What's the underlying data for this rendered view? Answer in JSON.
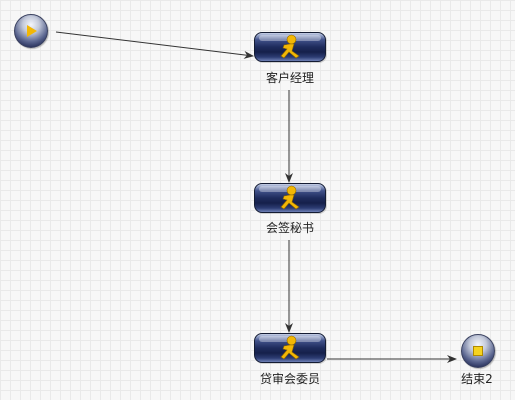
{
  "diagram": {
    "nodes": [
      {
        "id": "start",
        "kind": "start",
        "label": "",
        "icon": "play-icon"
      },
      {
        "id": "n1",
        "kind": "task",
        "label": "客户经理",
        "icon": "runner-icon"
      },
      {
        "id": "n2",
        "kind": "task",
        "label": "会签秘书",
        "icon": "runner-icon"
      },
      {
        "id": "n3",
        "kind": "task",
        "label": "贷审会委员",
        "icon": "runner-icon"
      },
      {
        "id": "end",
        "kind": "end",
        "label": "结束2",
        "icon": "stop-icon"
      }
    ],
    "edges": [
      {
        "from": "start",
        "to": "n1"
      },
      {
        "from": "n1",
        "to": "n2"
      },
      {
        "from": "n2",
        "to": "n3"
      },
      {
        "from": "n3",
        "to": "end"
      }
    ],
    "colors": {
      "task_fill": "#1e2b5c",
      "runner": "#f2b705",
      "edge": "#333333",
      "end_marker": "#f6d31f"
    }
  }
}
